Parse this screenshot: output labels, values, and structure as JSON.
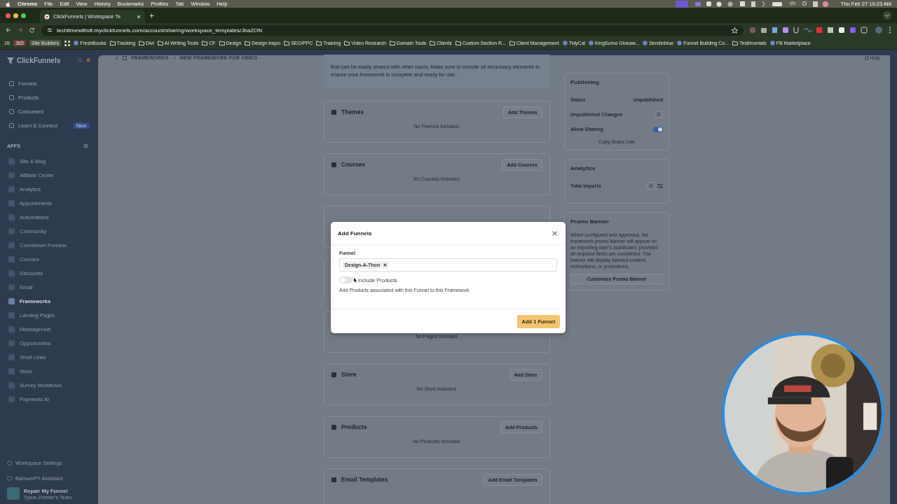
{
  "menu_bar": {
    "app": "Chrome",
    "items": [
      "File",
      "Edit",
      "View",
      "History",
      "Bookmarks",
      "Profiles",
      "Tab",
      "Window",
      "Help"
    ],
    "clock": "Thu Feb 27  10:23 AM"
  },
  "browser": {
    "tab_title": "ClickFunnels | Workspace Te",
    "url": "techtimewithdt.myclickfunnels.com/account/sharing/workspace_templates/JbaZON",
    "bookmarks": [
      {
        "kind": "text",
        "label": "JS"
      },
      {
        "kind": "tag",
        "label": "365",
        "color": "#6b3a3a"
      },
      {
        "kind": "tag",
        "label": "Site Builders",
        "color": "#4a5248"
      },
      {
        "kind": "apps"
      },
      {
        "kind": "site",
        "label": "FreshBooks"
      },
      {
        "kind": "folder",
        "label": "Tracking"
      },
      {
        "kind": "folder",
        "label": "Divi"
      },
      {
        "kind": "folder",
        "label": "AI Writing Tools"
      },
      {
        "kind": "folder",
        "label": "CF"
      },
      {
        "kind": "folder",
        "label": "Design"
      },
      {
        "kind": "folder",
        "label": "Design Inspo"
      },
      {
        "kind": "folder",
        "label": "SEO/PPC"
      },
      {
        "kind": "folder",
        "label": "Training"
      },
      {
        "kind": "folder",
        "label": "Video Research"
      },
      {
        "kind": "folder",
        "label": "Domain Tools"
      },
      {
        "kind": "folder",
        "label": "Clients"
      },
      {
        "kind": "folder",
        "label": "Custom Section R..."
      },
      {
        "kind": "folder",
        "label": "Client Management"
      },
      {
        "kind": "site",
        "label": "TidyCal"
      },
      {
        "kind": "site",
        "label": "KingSumo Giveaw..."
      },
      {
        "kind": "site",
        "label": "Sendinblue"
      },
      {
        "kind": "site",
        "label": "Funnel Building Co..."
      },
      {
        "kind": "folder",
        "label": "Testimonials"
      },
      {
        "kind": "site",
        "label": "FB Marketplace"
      }
    ]
  },
  "sidebar": {
    "brand": "ClickFunnels",
    "main_items": [
      {
        "label": "Funnels",
        "selected": false
      },
      {
        "label": "Products",
        "selected": false
      },
      {
        "label": "Customers",
        "selected": false
      },
      {
        "label": "Learn & Connect",
        "selected": false,
        "badge": "New"
      }
    ],
    "apps_heading": "APPS",
    "apps": [
      {
        "label": "Site & Blog",
        "selected": false
      },
      {
        "label": "Affiliate Center",
        "selected": false
      },
      {
        "label": "Analytics",
        "selected": false
      },
      {
        "label": "Appointments",
        "selected": false
      },
      {
        "label": "Automations",
        "selected": false
      },
      {
        "label": "Community",
        "selected": false
      },
      {
        "label": "Countdown Funnels",
        "selected": false
      },
      {
        "label": "Courses",
        "selected": false
      },
      {
        "label": "Discounts",
        "selected": false
      },
      {
        "label": "Email",
        "selected": false
      },
      {
        "label": "Frameworks",
        "selected": true
      },
      {
        "label": "Landing Pages",
        "selected": false
      },
      {
        "label": "MessageHub",
        "selected": false
      },
      {
        "label": "Opportunities",
        "selected": false
      },
      {
        "label": "Short Links",
        "selected": false
      },
      {
        "label": "Store",
        "selected": false
      },
      {
        "label": "Survey Workflows",
        "selected": false
      },
      {
        "label": "Payments AI",
        "selected": false
      }
    ],
    "footer_items": [
      "Workspace Settings",
      "BarnumPT Assistant"
    ],
    "account": {
      "name": "Repair My Funnel",
      "team": "Tyson Zimmer's Team"
    }
  },
  "breadcrumb": {
    "items": [
      "FRAMEWORKS",
      "NEW FRAMEWORK FOR VIDEO"
    ],
    "help": "Help"
  },
  "intro_text": "that can be easily shared with other users. Make sure to include all necessary elements to ensure your framework is complete and ready for use.",
  "sections": [
    {
      "kind": "section",
      "title": "Themes",
      "button": "Add Themes",
      "empty": "No Themes Included."
    },
    {
      "kind": "section",
      "title": "Courses",
      "button": "Add Courses",
      "empty": "No Courses Included."
    },
    {
      "kind": "covered"
    },
    {
      "kind": "covered"
    },
    {
      "kind": "partial",
      "empty": "No Pages Included."
    },
    {
      "kind": "section",
      "title": "Store",
      "button": "Add Store",
      "empty": "No Store Included."
    },
    {
      "kind": "section",
      "title": "Products",
      "button": "Add Products",
      "empty": "No Products Included."
    },
    {
      "kind": "section",
      "title": "Email Templates",
      "button": "Add Email Templates"
    }
  ],
  "publishing": {
    "title": "Publishing",
    "rows": [
      {
        "kind": "status",
        "label": "Status",
        "value": "Unpublished"
      },
      {
        "kind": "count",
        "label": "Unpublished Changes",
        "value": "0"
      },
      {
        "kind": "toggle",
        "label": "Allow Sharing",
        "on": true
      }
    ],
    "link": "Copy Share Link"
  },
  "analytics": {
    "title": "Analytics",
    "label": "Total Imports",
    "value": "0"
  },
  "promo_banner": {
    "title": "Promo Banner",
    "text": "When configured and approved, the framework promo banner will appear on an importing user's dashboard, provided all required fields are completed. The banner will display tailored content, instructions, or promotions.",
    "button": "Customize Promo Banner"
  },
  "modal": {
    "title": "Add Funnels",
    "field_label": "Funnel",
    "chips": [
      "Design-A-Thon"
    ],
    "include_products": {
      "label": "Include Products",
      "on": false
    },
    "help": "Add Products associated with this Funnel to this Framework",
    "button": "Add 1 Funnel"
  }
}
